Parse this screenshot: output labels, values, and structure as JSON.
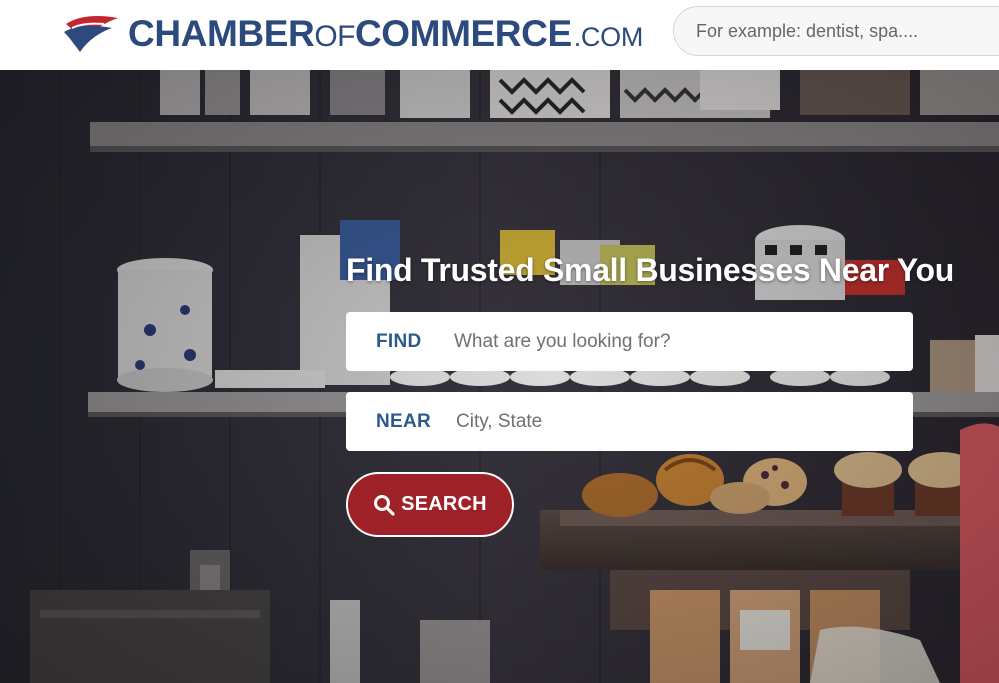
{
  "header": {
    "logo": {
      "word1": "CHAMBER",
      "word2": "OF",
      "word3": "COMMERCE",
      "suffix": ".COM"
    },
    "search_placeholder": "For example: dentist, spa...."
  },
  "hero": {
    "title": "Find Trusted Small Businesses Near You",
    "find": {
      "label": "FIND",
      "placeholder": "What are you looking for?"
    },
    "near": {
      "label": "NEAR",
      "placeholder": "City, State"
    },
    "search_button_label": "SEARCH"
  },
  "colors": {
    "brand_blue": "#2c4a7c",
    "brand_red": "#9e2127",
    "label_blue": "#2c5b8a"
  }
}
